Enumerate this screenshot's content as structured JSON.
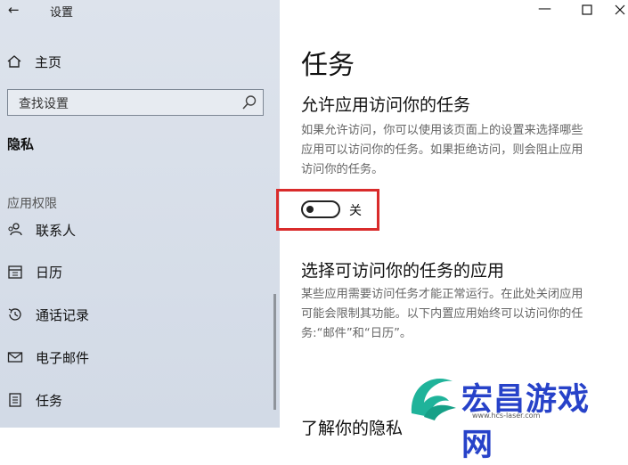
{
  "window": {
    "title": "设置"
  },
  "sidebar": {
    "home_label": "主页",
    "search_placeholder": "查找设置",
    "section_title": "隐私",
    "group_title": "应用权限",
    "items": [
      {
        "label": "联系人",
        "icon": "contacts-icon"
      },
      {
        "label": "日历",
        "icon": "calendar-icon"
      },
      {
        "label": "通话记录",
        "icon": "call-history-icon"
      },
      {
        "label": "电子邮件",
        "icon": "mail-icon"
      },
      {
        "label": "任务",
        "icon": "tasks-icon"
      }
    ]
  },
  "main": {
    "page_title": "任务",
    "section1": {
      "heading": "允许应用访问你的任务",
      "lines": [
        "如果允许访问，你可以使用该页面上的设置来选择哪些",
        "应用可以访问你的任务。如果拒绝访问，则会阻止应用",
        "访问你的任务。"
      ],
      "toggle_state": "off",
      "toggle_label": "关"
    },
    "section2": {
      "heading": "选择可访问你的任务的应用",
      "lines": [
        "某些应用需要访问任务才能正常运行。在此处关闭应用",
        "可能会限制其功能。以下内置应用始终可以访问你的任",
        "务:“邮件”和“日历”。"
      ]
    },
    "section3_heading": "了解你的隐私"
  },
  "watermark": {
    "text": "宏昌游戏网",
    "url": "www.hcs-laser.com"
  },
  "colors": {
    "highlight": "#d92b2b",
    "watermark": "#2742c9"
  }
}
